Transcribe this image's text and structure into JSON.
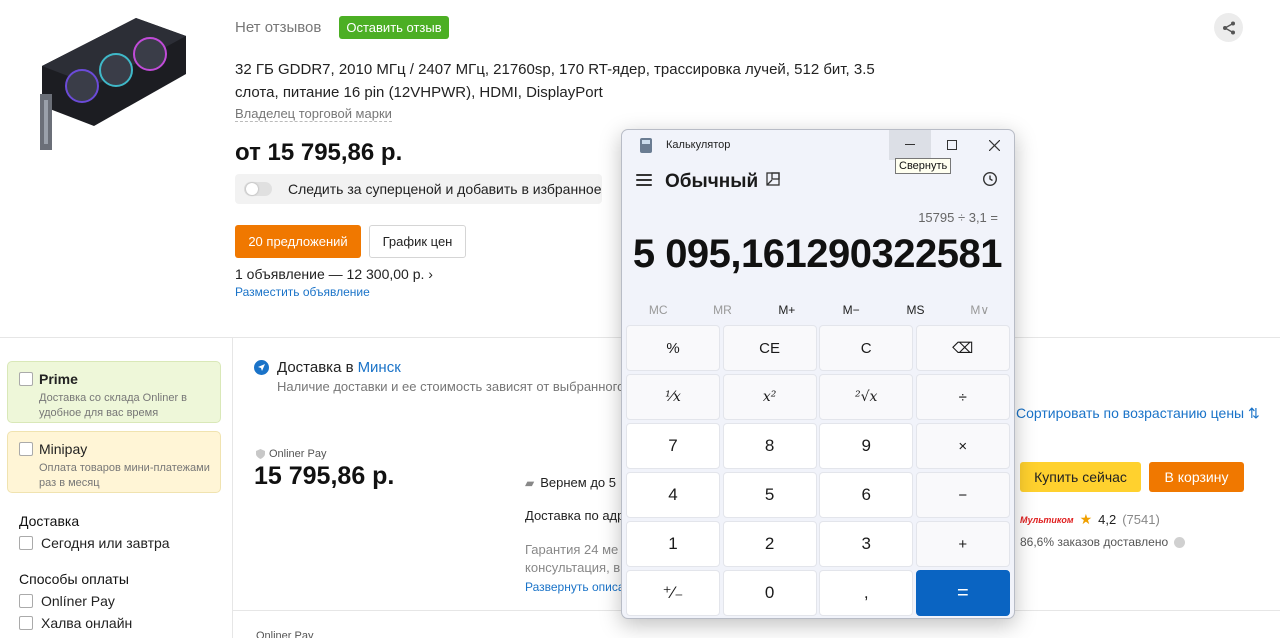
{
  "product": {
    "no_reviews": "Нет отзывов",
    "leave_review": "Оставить отзыв",
    "specs": "32 ГБ GDDR7, 2010 МГц / 2407 МГц, 21760sp, 170 RT-ядер, трассировка лучей, 512 бит, 3.5 слота, питание 16 pin (12VHPWR), HDMI, DisplayPort",
    "owner": "Владелец торговой марки",
    "price_from": "от 15 795,86 р.",
    "track_label": "Следить за суперценой и добавить в избранное",
    "offers_button": "20 предложений",
    "price_chart_button": "График цен",
    "ads_text": "1 объявление — 12 300,00 р.  ›",
    "post_ad": "Разместить объявление"
  },
  "sidebar": {
    "prime": {
      "title": "Prime",
      "desc": "Доставка со склада Onliner в удобное для вас время"
    },
    "minipay": {
      "title": "Minipay",
      "desc": "Оплата товаров мини-платежами раз в месяц"
    },
    "delivery_title": "Доставка",
    "delivery_option": "Сегодня или завтра",
    "payment_title": "Способы оплаты",
    "payment_options": [
      "Onlíner Pay",
      "Халва онлайн"
    ]
  },
  "delivery": {
    "label": "Доставка в",
    "city": "Минск",
    "note": "Наличие доставки и ее стоимость зависят от выбранного п",
    "onliner_pay_label": "Onliner Pay",
    "offer_price": "15 795,86 р.",
    "refund": "Вернем до 5",
    "address": "Доставка по адр",
    "warranty_line1": "Гарантия 24 ме",
    "warranty_line2": "консультация, в",
    "expand": "Развернуть описа",
    "sort": "Сортировать по возрастанию цены  ⇅",
    "buy_now": "Купить сейчас",
    "to_cart": "В корзину",
    "shop_logo": "Мультиком",
    "shop_rating": "4,2",
    "shop_reviews": "(7541)",
    "delivered_pct": "86,6% заказов доставлено",
    "next_label": "Onliner Pay"
  },
  "calculator": {
    "window_title": "Калькулятор",
    "minimize_tooltip": "Свернуть",
    "mode": "Обычный",
    "expression": "15795 ÷ 3,1 =",
    "result": "5 095,161290322581",
    "memory": [
      "MC",
      "MR",
      "M+",
      "M−",
      "MS",
      "M∨"
    ],
    "keys": [
      "%",
      "CE",
      "C",
      "⌫",
      "¹⁄x",
      "x²",
      "²√x",
      "÷",
      "7",
      "8",
      "9",
      "×",
      "4",
      "5",
      "6",
      "−",
      "1",
      "2",
      "3",
      "+",
      "⁺⁄₋",
      "0",
      ",",
      "="
    ]
  },
  "colors": {
    "accent_orange": "#f07800",
    "review_green": "#4caf24",
    "link_blue": "#1a73c8",
    "buy_yellow": "#ffd12e",
    "calc_equals": "#0a64c2"
  }
}
